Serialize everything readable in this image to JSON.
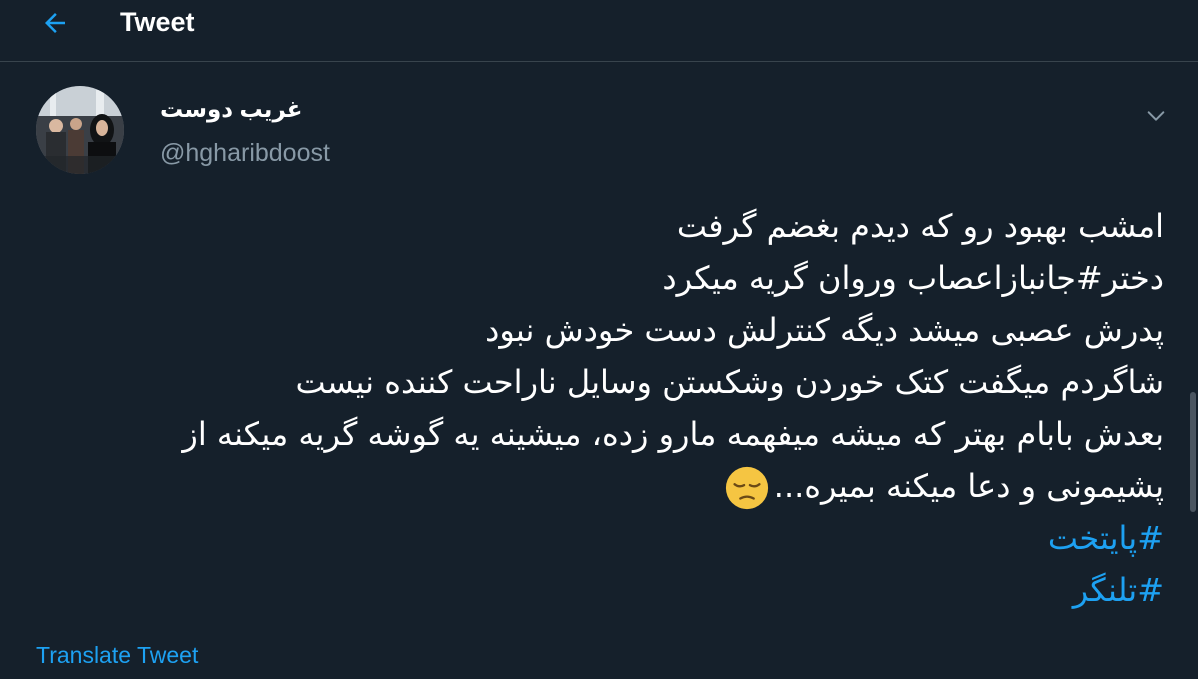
{
  "header": {
    "title": "Tweet",
    "back_icon": "arrow-left-icon"
  },
  "author": {
    "display_name": "غریب دوست",
    "handle": "@hgharibdoost",
    "avatar_icon": "profile-photo"
  },
  "tweet": {
    "lines": [
      "امشب بهبود رو که دیدم بغضم گرفت",
      "دختر#جانبازاعصاب وروان گریه میکرد",
      "پدرش عصبی میشد دیگه کنترلش دست خودش نبود",
      "شاگردم میگفت کتک خوردن وشکستن وسایل ناراحت کننده نیست",
      "بعدش بابام بهتر که میشه میفهمه مارو زده، میشینه یه گوشه گریه میکنه از",
      "پشیمونی و دعا میکنه بمیره..."
    ],
    "emoji": "pensive-face-emoji",
    "hashtags": [
      "#پایتخت",
      "#تلنگر"
    ]
  },
  "translate_label": "Translate Tweet",
  "colors": {
    "background": "#15202b",
    "accent": "#1da1f2",
    "secondary_text": "#8899a6",
    "divider": "#38444d"
  }
}
